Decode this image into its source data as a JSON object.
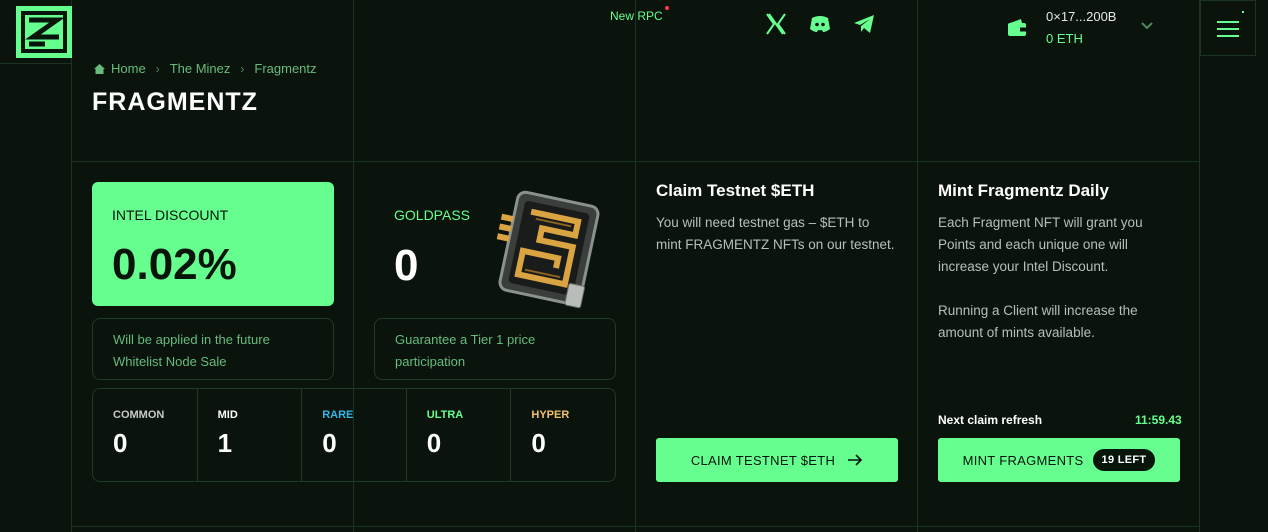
{
  "header": {
    "rpc_label": "New RPC",
    "socials": [
      {
        "name": "x-icon"
      },
      {
        "name": "discord-icon"
      },
      {
        "name": "telegram-icon"
      }
    ],
    "wallet": {
      "address": "0×17...200B",
      "balance": "0 ETH"
    }
  },
  "breadcrumb": {
    "home": "Home",
    "parent": "The Minez",
    "current": "Fragmentz"
  },
  "page_title": "FRAGMENTZ",
  "intel": {
    "label": "INTEL DISCOUNT",
    "value": "0.02%",
    "note": "Will be applied in the future Whitelist Node Sale"
  },
  "goldpass": {
    "label": "GOLDPASS",
    "value": "0",
    "note": "Guarantee a Tier 1 price participation"
  },
  "tiers": [
    {
      "name": "COMMON",
      "count": "0",
      "color": "#c9c9c9"
    },
    {
      "name": "MID",
      "count": "1",
      "color": "#ffffff"
    },
    {
      "name": "RARE",
      "count": "0",
      "color": "#35b8e8"
    },
    {
      "name": "ULTRA",
      "count": "0",
      "color": "#66ff8f"
    },
    {
      "name": "HYPER",
      "count": "0",
      "color": "#f2c16b"
    }
  ],
  "claim": {
    "title": "Claim Testnet $ETH",
    "body": "You will need testnet gas – $ETH to mint FRAGMENTZ NFTs on our testnet.",
    "button": "CLAIM TESTNET $ETH"
  },
  "mint": {
    "title": "Mint Fragmentz Daily",
    "body1": "Each Fragment NFT will grant you Points and each unique one will increase your Intel Discount.",
    "body2": "Running a Client will increase the amount of mints available.",
    "refresh_label": "Next claim refresh",
    "refresh_time": "11:59.43",
    "button": "MINT FRAGMENTS",
    "badge": "19 LEFT"
  },
  "colors": {
    "accent": "#66ff8f",
    "background": "#0a130c",
    "grid": "#1c3322"
  }
}
